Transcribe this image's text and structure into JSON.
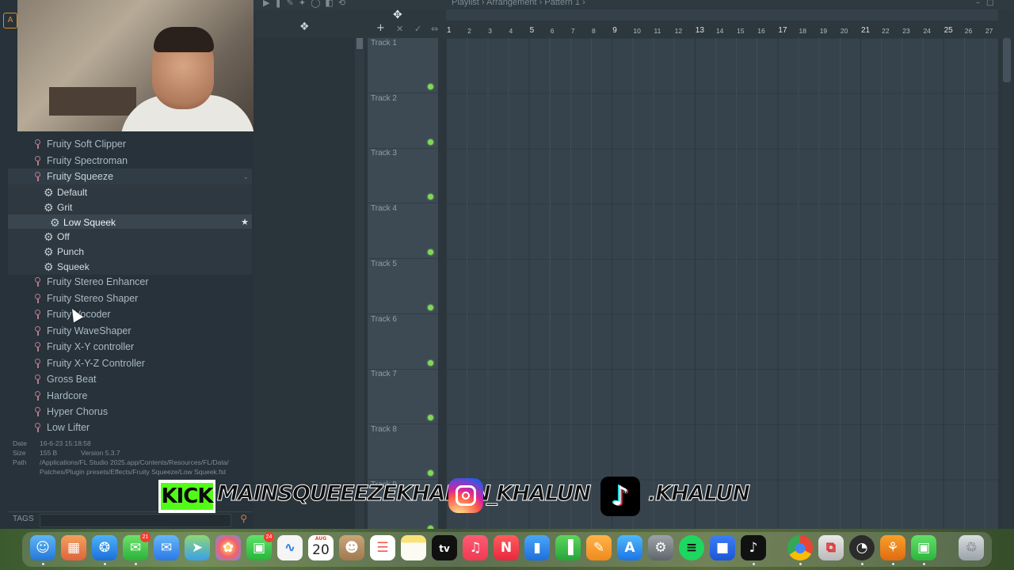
{
  "colors": {
    "accent_orange": "#d8902e",
    "track_led": "#7ed957",
    "kick_green": "#53fc18"
  },
  "playlist": {
    "breadcrumb": [
      "Playlist",
      "Arrangement",
      "Pattern 1"
    ],
    "bar_numbers": [
      "1",
      "2",
      "3",
      "4",
      "5",
      "6",
      "7",
      "8",
      "9",
      "10",
      "11",
      "12",
      "13",
      "14",
      "15",
      "16",
      "17",
      "18",
      "19",
      "20",
      "21",
      "22",
      "23",
      "24",
      "25",
      "26",
      "27"
    ],
    "tracks": [
      "Track 1",
      "Track 2",
      "Track 3",
      "Track 4",
      "Track 5",
      "Track 6",
      "Track 7",
      "Track 8",
      "Track 9"
    ]
  },
  "browser": {
    "items": [
      {
        "type": "plugin",
        "label": "Fruity Soft Clipper"
      },
      {
        "type": "plugin",
        "label": "Fruity Spectroman"
      },
      {
        "type": "plugin",
        "label": "Fruity Squeeze",
        "expanded": true
      },
      {
        "type": "preset",
        "label": "Default"
      },
      {
        "type": "preset",
        "label": "Grit"
      },
      {
        "type": "preset",
        "label": "Low Squeek",
        "selected": true
      },
      {
        "type": "preset",
        "label": "Off"
      },
      {
        "type": "preset",
        "label": "Punch"
      },
      {
        "type": "preset",
        "label": "Squeek"
      },
      {
        "type": "plugin",
        "label": "Fruity Stereo Enhancer"
      },
      {
        "type": "plugin",
        "label": "Fruity Stereo Shaper"
      },
      {
        "type": "plugin",
        "label": "Fruity Vocoder"
      },
      {
        "type": "plugin",
        "label": "Fruity WaveShaper"
      },
      {
        "type": "plugin",
        "label": "Fruity X-Y controller"
      },
      {
        "type": "plugin",
        "label": "Fruity X-Y-Z Controller"
      },
      {
        "type": "plugin",
        "label": "Gross Beat"
      },
      {
        "type": "plugin",
        "label": "Hardcore"
      },
      {
        "type": "plugin",
        "label": "Hyper Chorus"
      },
      {
        "type": "plugin",
        "label": "Low Lifter"
      }
    ],
    "file_info": {
      "date_label": "Date",
      "date": "16-6-23 15:18:58",
      "size_label": "Size",
      "size": "155 B",
      "version": "Version 5.3.7",
      "path_label": "Path",
      "path_line1": "/Applications/FL Studio 2025.app/Contents/Resources/FL/Data/",
      "path_line2": "Patches/Plugin presets/Effects/Fruity Squeeze/Low Squeek.fst"
    },
    "tags_label": "TAGS"
  },
  "overlay": {
    "kick_logo": "KICK",
    "kick_handle": "MAINSQUEEEZEKHALUN",
    "instagram_handle": "_KHALUN",
    "tiktok_handle": ".KHALUN"
  },
  "dock": {
    "calendar_month": "AUG",
    "calendar_day": "20",
    "messages_badge": "21",
    "facetime_badge": "24",
    "tv_label": "tv"
  }
}
